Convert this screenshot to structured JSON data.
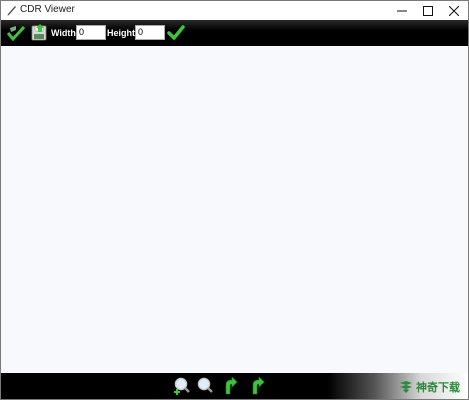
{
  "window": {
    "title": "CDR Viewer"
  },
  "toolbar": {
    "width_label": "Width",
    "width_value": "0",
    "height_label": "Height",
    "height_value": "0"
  },
  "watermark": {
    "text": "神奇下载"
  },
  "colors": {
    "toolbar_bg": "#000000",
    "canvas_bg": "#f8f9fd",
    "accent_green": "#3cc43c"
  },
  "icons": {
    "toolbar": [
      "open-check-icon",
      "save-icon",
      "apply-check-icon"
    ],
    "bottom": [
      "zoom-in-icon",
      "zoom-out-icon",
      "rotate-left-icon",
      "rotate-right-icon"
    ]
  }
}
